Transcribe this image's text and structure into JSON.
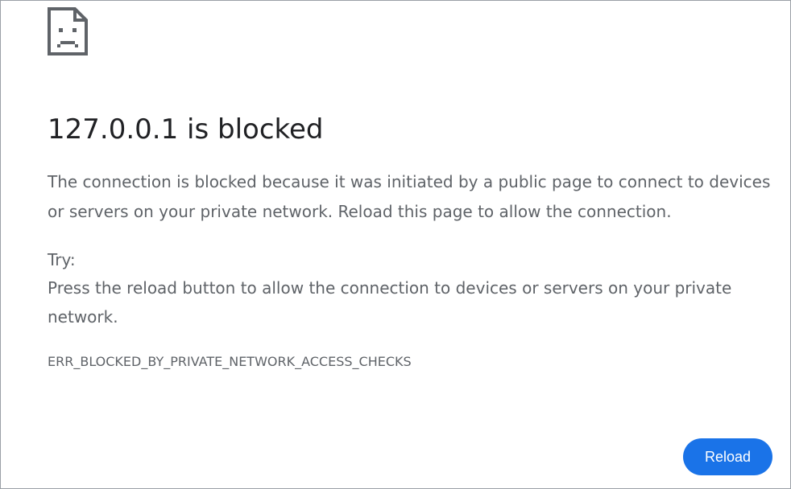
{
  "error_page": {
    "icon": "sad-page-icon",
    "headline": "127.0.0.1 is blocked",
    "description": "The connection is blocked because it was initiated by a public page to connect to devices or servers on your private network. Reload this page to allow the connection.",
    "try_label": "Try:",
    "try_text": "Press the reload button to allow the connection to devices or servers on your private network.",
    "error_code": "ERR_BLOCKED_BY_PRIVATE_NETWORK_ACCESS_CHECKS",
    "reload_label": "Reload"
  },
  "colors": {
    "accent": "#1a73e8",
    "headline": "#202124",
    "body_text": "#5f6368"
  }
}
